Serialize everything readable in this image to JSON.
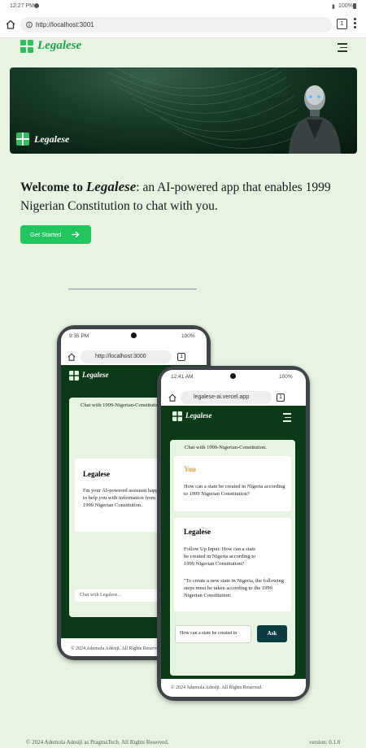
{
  "status_bar": {
    "time": "12:27 PM",
    "battery": "100%"
  },
  "browser": {
    "url": "http://localhost:3001",
    "tab_count": "1"
  },
  "header": {
    "brand": "Legalese"
  },
  "banner": {
    "brand": "Legalese"
  },
  "hero": {
    "welcome_prefix": "Welcome to",
    "brand": "Legalese",
    "welcome_suffix": ": an AI-powered app that enables 1999 Nigerian Constitution to chat with you.",
    "cta_label": "Get Started"
  },
  "phone_back": {
    "status_time": "9:35 PM",
    "battery": "100%",
    "url": "http://localhost:3000",
    "tab_count": "1",
    "brand": "Legalese",
    "chat_title": "Chat with 1999-Nigerian-Constitution.",
    "bot_name": "Legalese",
    "bot_message": "I'm your AI-powered assistant happy to help you with information from 1999 Nigerian Constitution.",
    "input_placeholder": "Chat with Legalese...",
    "footer": "© 2024 Ademola Adesiji. All Rights Reserved."
  },
  "phone_front": {
    "status_time": "12:41 AM",
    "battery": "100%",
    "url": "legalese-ai.vercel.app",
    "tab_count": "1",
    "brand": "Legalese",
    "chat_title": "Chat with 1999-Nigerian-Constitution.",
    "user_name": "You",
    "user_message": "How can a state be created in Nigeria according to 1999 Nigerian Constitution?",
    "bot_name": "Legalese",
    "bot_line1": "Follow Up Input: How can a state be created in Nigeria according to 1999 Nigerian Constitution?",
    "bot_line2": "\"To create a new state in Nigeria, the following steps must be taken according to the 1999 Nigerian Constitution:",
    "input_value": "How can a state be created in",
    "ask_label": "Ask",
    "footer": "© 2024 Ademola Adesiji. All Rights Reserved."
  },
  "page_footer": {
    "copyright": "© 2024 Ademola Adesiji as PragmaTech. All Rights Reserved.",
    "version": "version: 0.1.0"
  },
  "colors": {
    "accent": "#22c55e",
    "dark_green": "#0b3a17",
    "background": "#e6f4e1",
    "brand_green": "#1ea34d"
  }
}
